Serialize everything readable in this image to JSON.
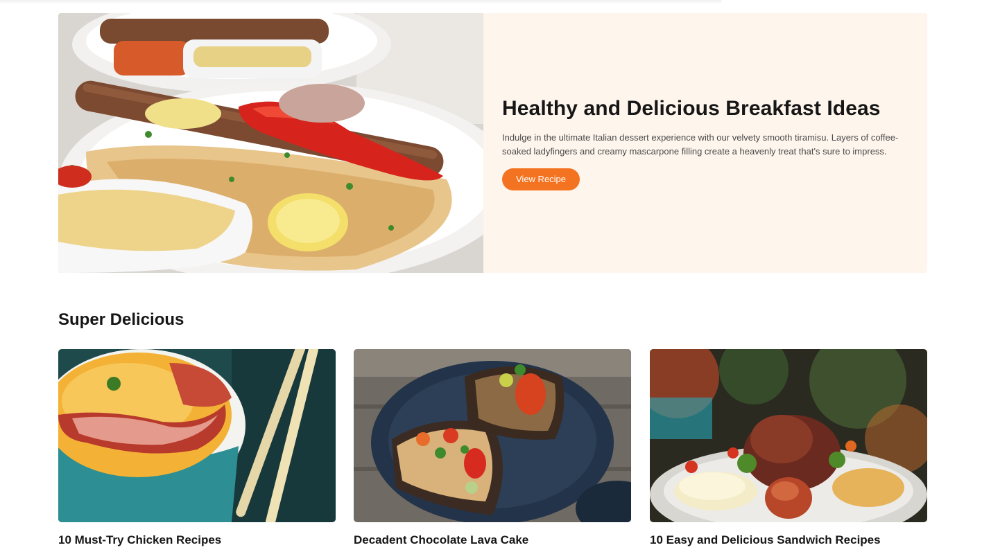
{
  "hero": {
    "title": "Healthy and Delicious Breakfast Ideas",
    "description": "Indulge in the ultimate Italian dessert experience with our velvety smooth tiramisu. Layers of coffee-soaked ladyfingers and creamy mascarpone filling create a heavenly treat that's sure to impress.",
    "button_label": "View Recipe",
    "image": "kebab-plate-photo"
  },
  "section": {
    "title": "Super Delicious"
  },
  "cards": [
    {
      "title": "10 Must-Try Chicken Recipes",
      "image": "soup-bacon-photo"
    },
    {
      "title": "Decadent Chocolate Lava Cake",
      "image": "toast-plate-photo"
    },
    {
      "title": "10 Easy and Delicious Sandwich Recipes",
      "image": "salad-plate-photo"
    }
  ],
  "colors": {
    "accent": "#f47320",
    "hero_panel": "#fef5ed",
    "heading": "#161616",
    "body_text": "#4a4a4a"
  }
}
